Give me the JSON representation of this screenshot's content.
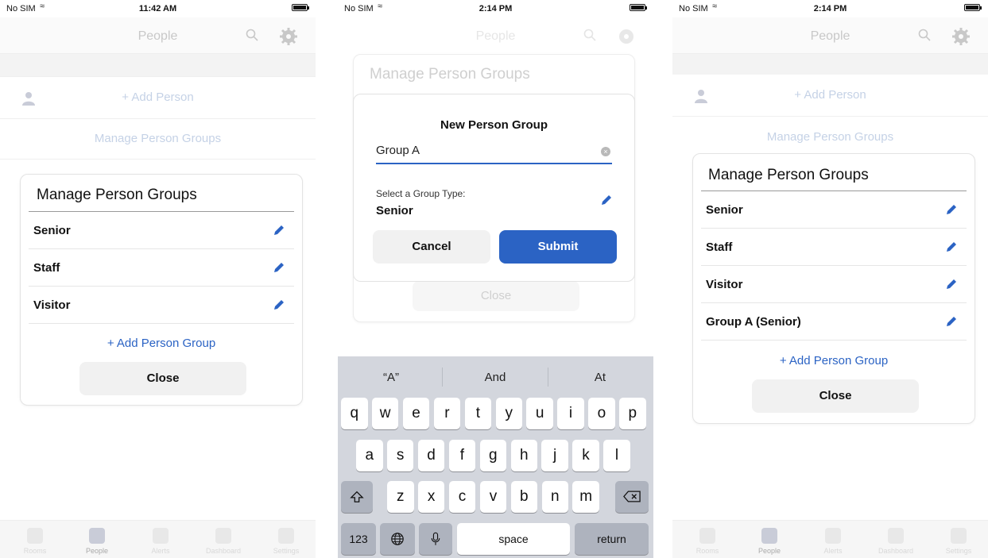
{
  "screens": [
    {
      "status": {
        "carrier": "No SIM",
        "time": "11:42 AM"
      },
      "nav": {
        "title": "People"
      },
      "bg": {
        "add_person": "+ Add Person",
        "manage_groups": "Manage Person Groups"
      },
      "card": {
        "title": "Manage Person Groups",
        "items": [
          "Senior",
          "Staff",
          "Visitor"
        ],
        "add_group": "+ Add Person Group",
        "close": "Close"
      },
      "tabs": [
        "Rooms",
        "People",
        "Alerts",
        "Dashboard",
        "Settings"
      ]
    },
    {
      "status": {
        "carrier": "No SIM",
        "time": "2:14 PM"
      },
      "nav": {
        "title": "People"
      },
      "bg": {
        "manage_groups": "Manage Person Groups",
        "close": "Close"
      },
      "modal": {
        "title": "New Person Group",
        "input_value": "Group A",
        "group_type_label": "Select a Group Type:",
        "group_type_value": "Senior",
        "cancel": "Cancel",
        "submit": "Submit"
      },
      "keyboard": {
        "suggestions": [
          "“A”",
          "And",
          "At"
        ],
        "row1": [
          "q",
          "w",
          "e",
          "r",
          "t",
          "y",
          "u",
          "i",
          "o",
          "p"
        ],
        "row2": [
          "a",
          "s",
          "d",
          "f",
          "g",
          "h",
          "j",
          "k",
          "l"
        ],
        "row3": [
          "z",
          "x",
          "c",
          "v",
          "b",
          "n",
          "m"
        ],
        "numbers": "123",
        "space": "space",
        "return": "return"
      }
    },
    {
      "status": {
        "carrier": "No SIM",
        "time": "2:14 PM"
      },
      "nav": {
        "title": "People"
      },
      "bg": {
        "add_person": "+ Add Person",
        "manage_groups": "Manage Person Groups"
      },
      "card": {
        "title": "Manage Person Groups",
        "items": [
          "Senior",
          "Staff",
          "Visitor",
          "Group A (Senior)"
        ],
        "add_group": "+ Add Person Group",
        "close": "Close"
      },
      "tabs": [
        "Rooms",
        "People",
        "Alerts",
        "Dashboard",
        "Settings"
      ]
    }
  ],
  "colors": {
    "accent": "#2b63c4",
    "muted_title": "#c8c8c8"
  },
  "icons": [
    "search-icon",
    "gear-icon",
    "pencil-icon",
    "shift-icon",
    "backspace-icon",
    "globe-icon",
    "mic-icon",
    "person-icon",
    "wifi-icon",
    "battery-icon"
  ]
}
